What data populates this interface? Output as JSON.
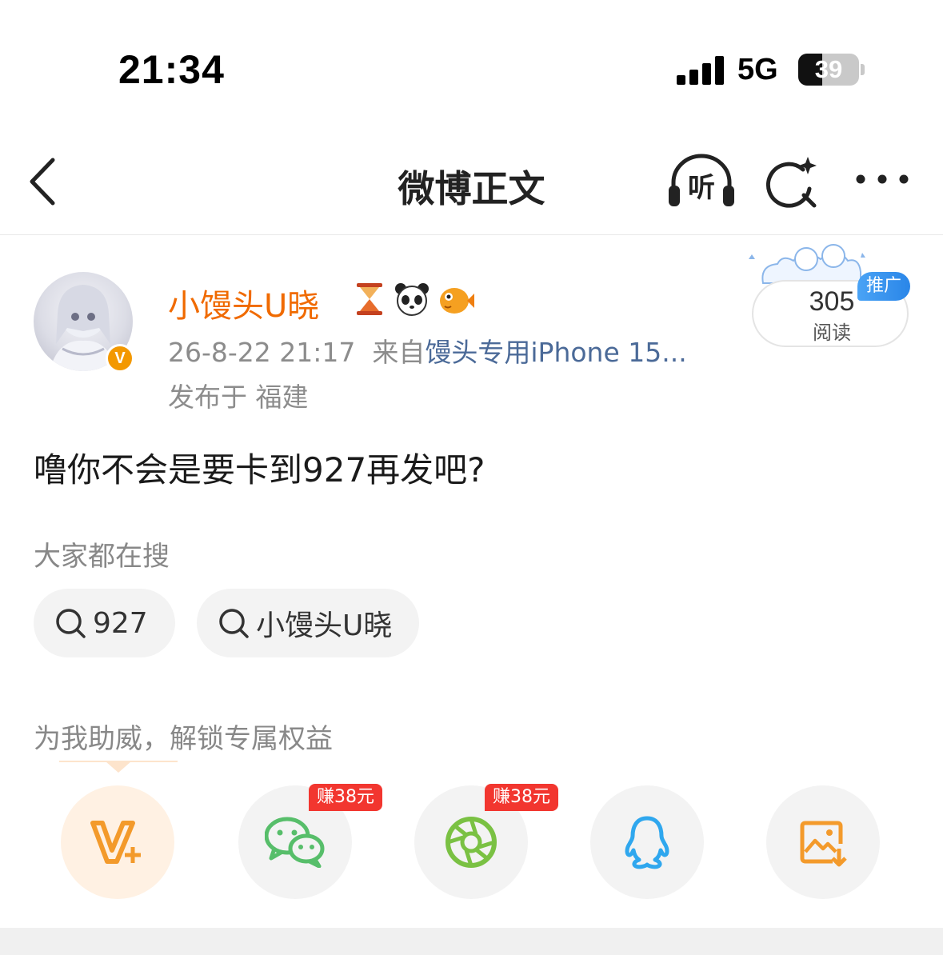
{
  "status_bar": {
    "time": "21:34",
    "network": "5G",
    "battery": "39",
    "battery_level": 0.39
  },
  "nav": {
    "title": "微博正文",
    "listen_label": "听"
  },
  "post": {
    "username": "小馒头U晓",
    "timestamp": "26-8-22 21:17",
    "source_prefix": "来自",
    "source": "馒头专用iPhone 15...",
    "location": "发布于 福建",
    "read_count": "305",
    "read_label": "阅读",
    "promo_label": "推广",
    "verified_mark": "V",
    "text": "噜你不会是要卡到927再发吧?"
  },
  "hot_search": {
    "title": "大家都在搜",
    "items": [
      "927",
      "小馒头U晓"
    ]
  },
  "support": {
    "title": "为我助威，解锁专属权益",
    "earn_tags": [
      "赚38元",
      "赚38元"
    ],
    "buttons": [
      {
        "icon": "vplus-icon"
      },
      {
        "icon": "wechat-icon"
      },
      {
        "icon": "moments-icon"
      },
      {
        "icon": "qq-icon"
      },
      {
        "icon": "save-image-icon"
      }
    ]
  },
  "colors": {
    "username": "#f06a00",
    "source_link": "#4b6a98",
    "earn_tag": "#f2362f",
    "promo_badge": "#2a86e8",
    "wechat": "#57be6a",
    "qq": "#2fa7ee",
    "vplus": "#f39a2b"
  }
}
